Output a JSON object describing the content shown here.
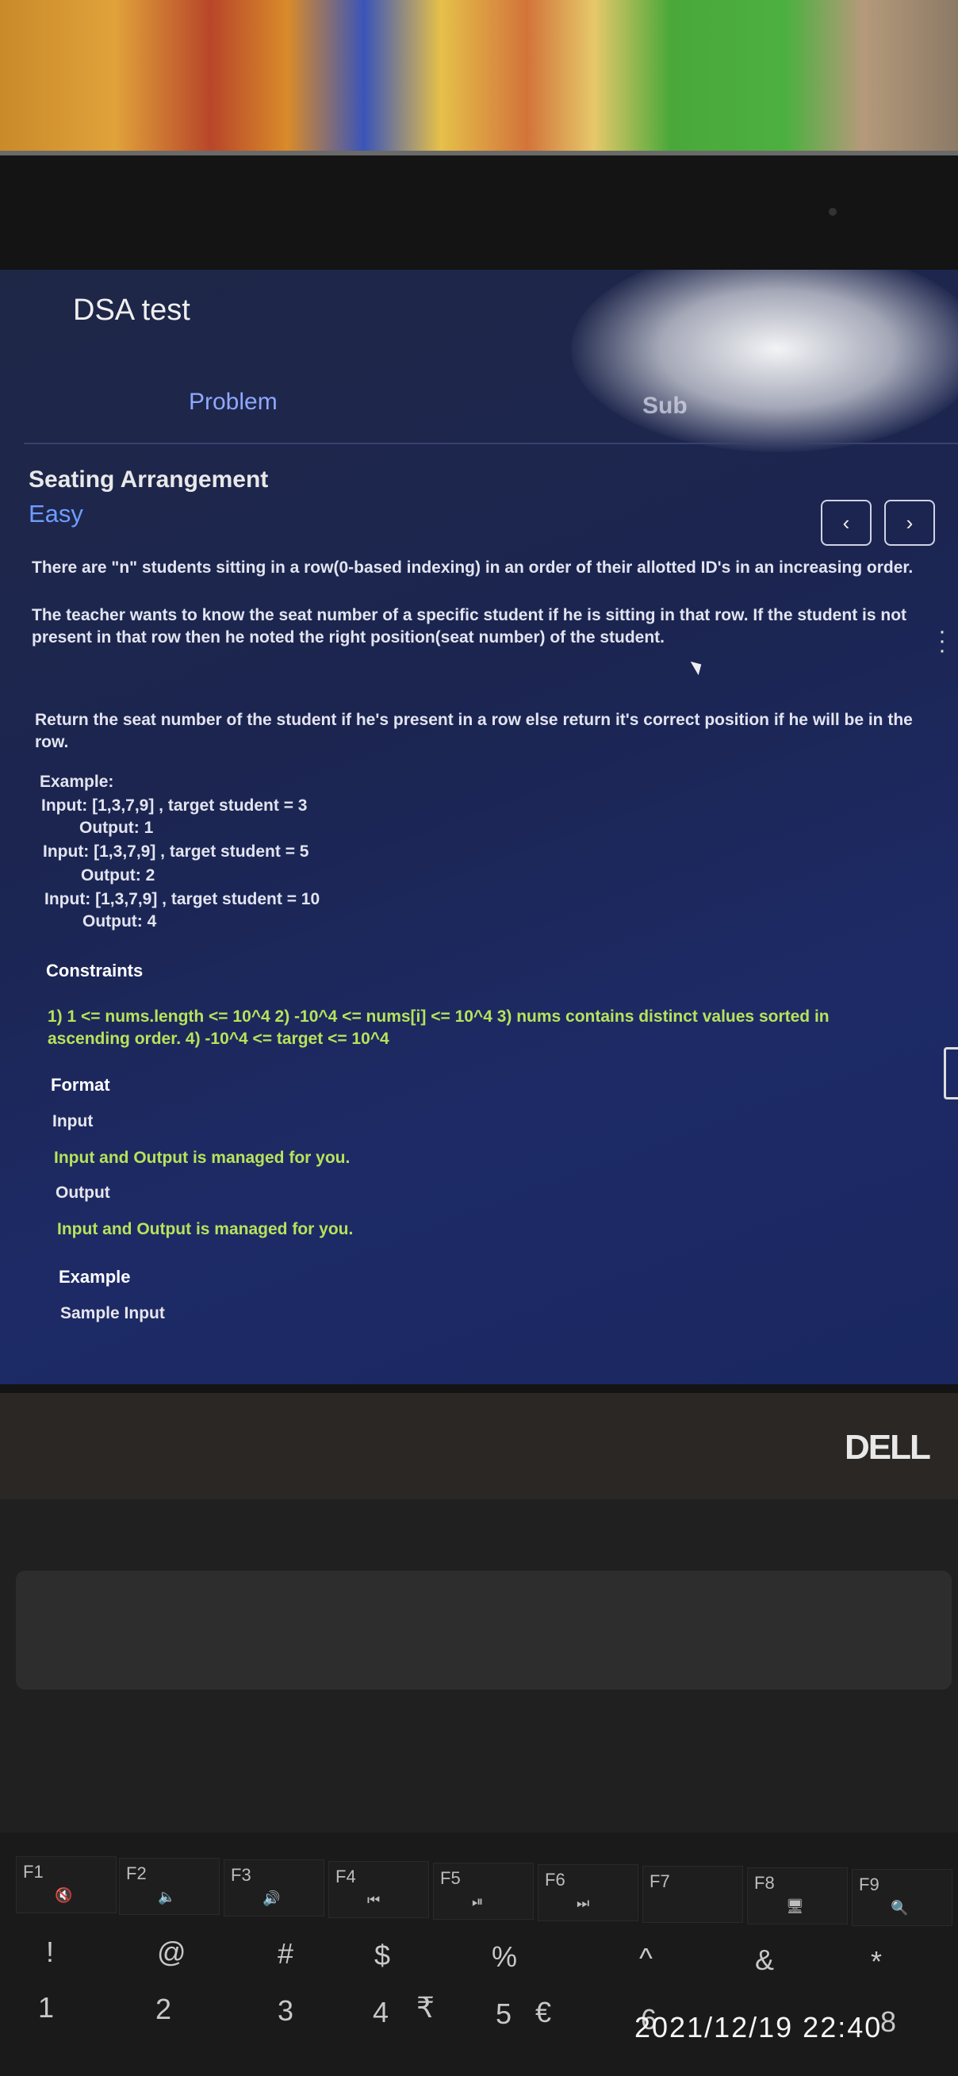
{
  "app": {
    "title": "DSA test"
  },
  "tabs": {
    "problem": "Problem",
    "submit": "Sub"
  },
  "question": {
    "title": "Seating Arrangement",
    "difficulty": "Easy",
    "prev_icon": "chevron-left-icon",
    "next_icon": "chevron-right-icon",
    "description_1": "There are \"n\" students sitting in a row(0-based indexing) in an order of their allotted ID's in an increasing order.",
    "description_2": "The teacher wants to know the seat number of a specific student if he is sitting in that row. If the student is not present in that row then he noted the right position(seat number) of the student.",
    "description_3": "Return the seat number of the student if he's present in a row else return it's correct position if he will be in the row.",
    "example_heading": "Example:",
    "examples": [
      {
        "input": "Input: [1,3,7,9] , target student = 3",
        "output": "Output: 1"
      },
      {
        "input": "Input: [1,3,7,9] , target student = 5",
        "output": "Output: 2"
      },
      {
        "input": "Input: [1,3,7,9] , target student = 10",
        "output": "Output: 4"
      }
    ],
    "constraints_heading": "Constraints",
    "constraints": "1) 1 <= nums.length <= 10^4 2) -10^4 <= nums[i] <= 10^4 3) nums contains distinct values sorted in ascending order. 4) -10^4 <= target <= 10^4",
    "format_heading": "Format",
    "input_label": "Input",
    "input_text": "Input and Output is managed for you.",
    "output_label": "Output",
    "output_text": "Input and Output is managed for you.",
    "sample_heading": "Example",
    "sample_input_label": "Sample Input"
  },
  "laptop": {
    "brand": "DELL"
  },
  "keyboard": {
    "fkeys": [
      {
        "label": "F1",
        "icon": "🔇"
      },
      {
        "label": "F2",
        "icon": "🔈"
      },
      {
        "label": "F3",
        "icon": "🔊"
      },
      {
        "label": "F4",
        "icon": "⏮"
      },
      {
        "label": "F5",
        "icon": "⏯"
      },
      {
        "label": "F6",
        "icon": "⏭"
      },
      {
        "label": "F7",
        "icon": ""
      },
      {
        "label": "F8",
        "icon": "🖥"
      },
      {
        "label": "F9",
        "icon": "🔍"
      }
    ],
    "symbols": [
      "!",
      "@",
      "#",
      "$",
      "%",
      "^",
      "&",
      "*"
    ],
    "numbers": [
      "1",
      "2",
      "3",
      "4",
      "₹",
      "5",
      "€",
      "6",
      "8"
    ]
  },
  "timestamp": "2021/12/19 22:40"
}
